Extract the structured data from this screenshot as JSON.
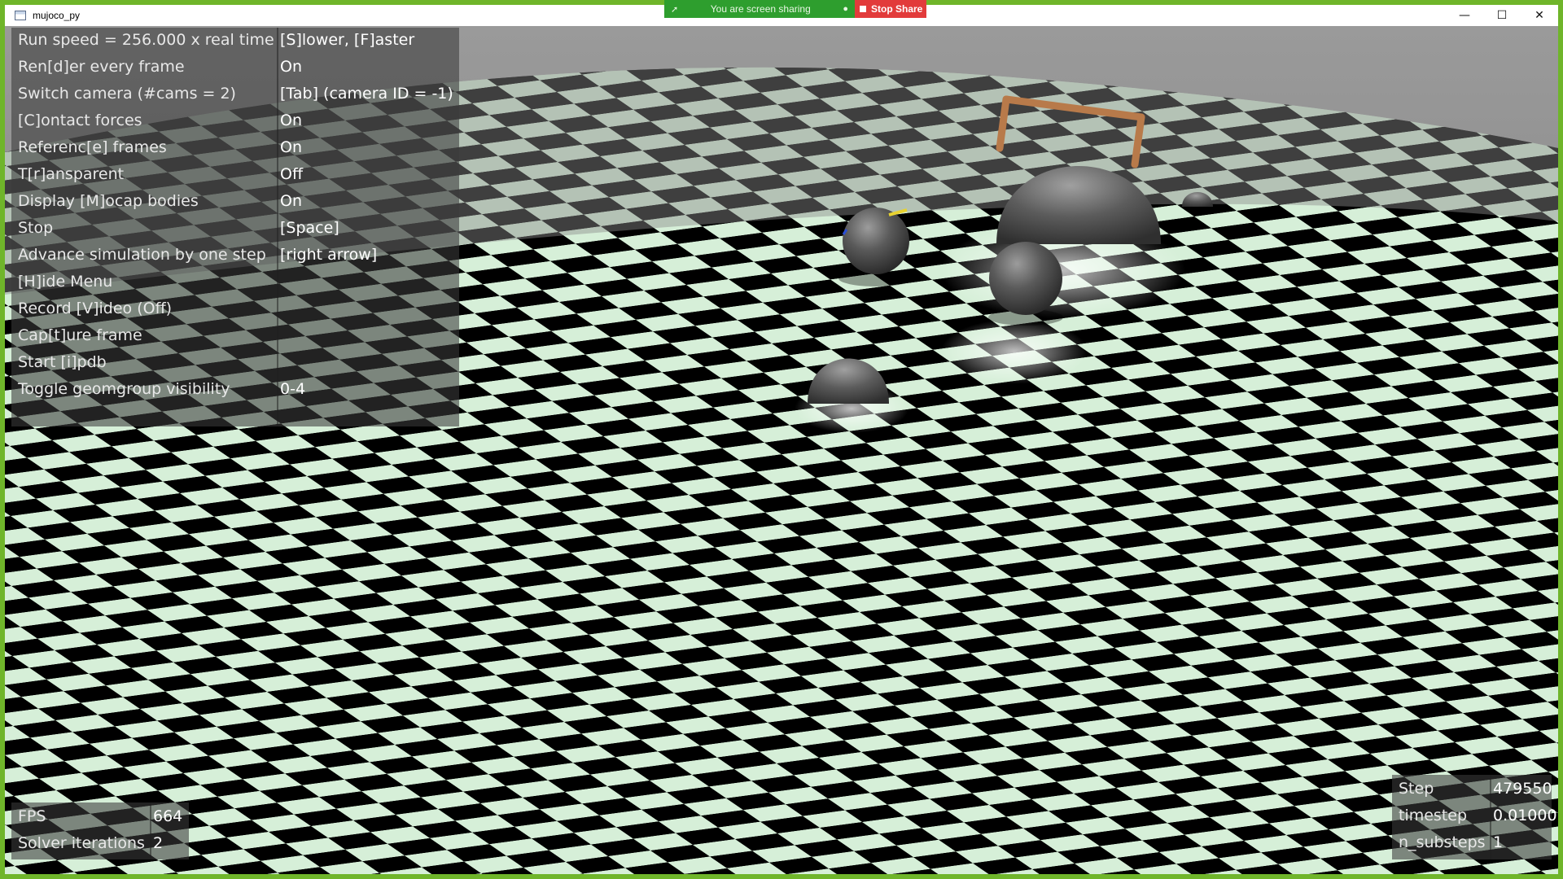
{
  "window": {
    "title": "mujoco_py",
    "controls": {
      "minimize": "—",
      "maximize": "☐",
      "close": "✕"
    }
  },
  "share_bar": {
    "status": "You are screen sharing",
    "stop_label": "Stop Share",
    "colors": {
      "status_bg": "#2e9e2e",
      "stop_bg": "#e23b3b"
    }
  },
  "menu": {
    "items": [
      {
        "label": "Run speed = 256.000 x real time",
        "value": "[S]lower, [F]aster"
      },
      {
        "label": "Ren[d]er every frame",
        "value": "On"
      },
      {
        "label": "Switch camera (#cams = 2)",
        "value": "[Tab] (camera ID = -1)"
      },
      {
        "label": "[C]ontact forces",
        "value": "On"
      },
      {
        "label": "Referenc[e] frames",
        "value": "On"
      },
      {
        "label": "T[r]ansparent",
        "value": "Off"
      },
      {
        "label": "Display [M]ocap bodies",
        "value": "On"
      },
      {
        "label": "Stop",
        "value": "[Space]"
      },
      {
        "label": "Advance simulation by one step",
        "value": "[right arrow]"
      },
      {
        "label": "[H]ide Menu",
        "value": ""
      },
      {
        "label": "Record [V]ideo (Off)",
        "value": ""
      },
      {
        "label": "Cap[t]ure frame",
        "value": ""
      },
      {
        "label": "Start [i]pdb",
        "value": ""
      },
      {
        "label": "Toggle geomgroup visibility",
        "value": "0-4"
      }
    ]
  },
  "stats_left": {
    "items": [
      {
        "label": "FPS",
        "value": "664"
      },
      {
        "label": "Solver iterations",
        "value": "2"
      }
    ]
  },
  "stats_right": {
    "items": [
      {
        "label": "Step",
        "value": "479550"
      },
      {
        "label": "timestep",
        "value": "0.01000"
      },
      {
        "label": "n_substeps",
        "value": "1"
      }
    ]
  },
  "scene": {
    "colors": {
      "sky": "#8a8a8a",
      "checker_dark": "#000000",
      "checker_light": "#d6efd8",
      "sphere": "#555555",
      "frame": "#b87a4a"
    }
  }
}
